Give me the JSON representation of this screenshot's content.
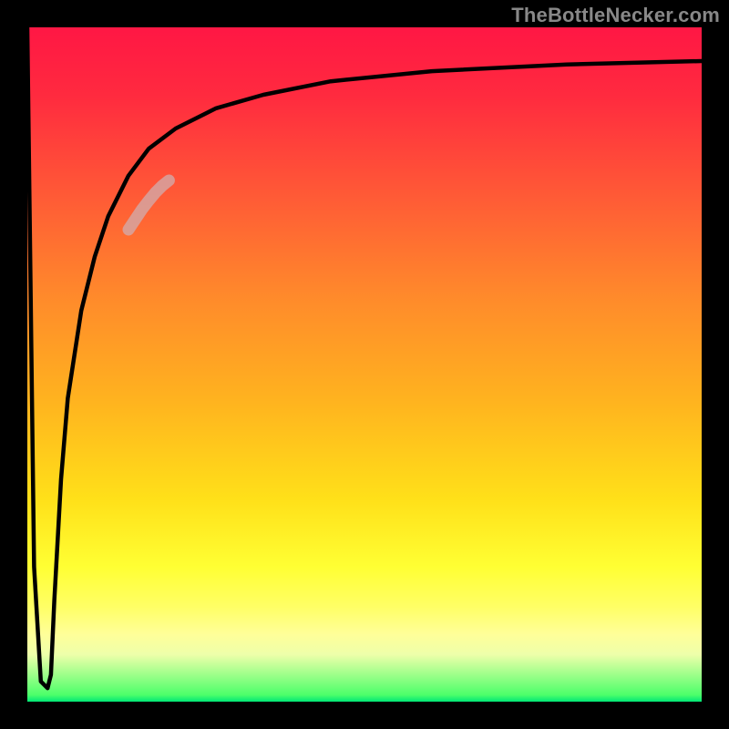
{
  "attribution": "TheBottleNecker.com",
  "chart_data": {
    "type": "line",
    "title": "",
    "xlabel": "",
    "ylabel": "",
    "xlim": [
      0,
      100
    ],
    "ylim": [
      0,
      100
    ],
    "legend": false,
    "grid": false,
    "background": "vertical-gradient red→yellow→green",
    "series": [
      {
        "name": "bottleneck-curve",
        "color": "#000000",
        "x": [
          0.0,
          0.5,
          1.0,
          2.0,
          3.0,
          3.5,
          4.0,
          5.0,
          6.0,
          8.0,
          10.0,
          12.0,
          15.0,
          18.0,
          22.0,
          28.0,
          35.0,
          45.0,
          60.0,
          80.0,
          100.0
        ],
        "y": [
          100,
          60,
          20,
          3,
          2,
          4,
          15,
          33,
          45,
          58,
          66,
          72,
          78,
          82,
          85,
          88,
          90,
          92,
          93.5,
          94.5,
          95.0
        ]
      },
      {
        "name": "highlight-segment",
        "color": "rgba(210,170,170,0.75)",
        "x": [
          15.0,
          16.0,
          17.0,
          18.0,
          19.0,
          20.0,
          21.0
        ],
        "y": [
          70.0,
          71.5,
          73.0,
          74.3,
          75.5,
          76.5,
          77.3
        ]
      }
    ]
  }
}
